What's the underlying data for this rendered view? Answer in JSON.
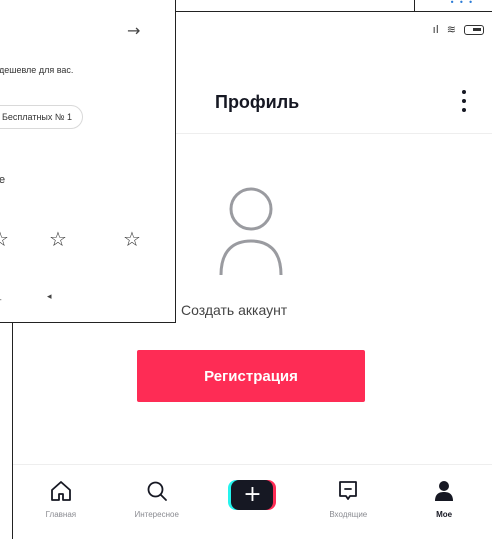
{
  "status_bar": {
    "signal_icon": "signal-icon",
    "wifi_icon": "wifi-icon",
    "battery_icon": "battery-icon"
  },
  "profile": {
    "title": "Профиль",
    "create_account": "Создать аккаунт",
    "register_label": "Регистрация",
    "accent_color": "#fe2c55"
  },
  "tabs": [
    {
      "label": "Главная",
      "icon": "home-icon",
      "active": false
    },
    {
      "label": "Интересное",
      "icon": "search-icon",
      "active": false
    },
    {
      "label": "",
      "icon": "plus-icon",
      "active": false
    },
    {
      "label": "Входящие",
      "icon": "inbox-icon",
      "active": false
    },
    {
      "label": "Мое",
      "icon": "person-icon",
      "active": true
    }
  ],
  "panel": {
    "arrow": "→",
    "text": "дешевле для вас.",
    "chip": "Бесплатных № 1",
    "label": "е",
    "star": "☆",
    "sound": "◂",
    "dash": "-"
  }
}
